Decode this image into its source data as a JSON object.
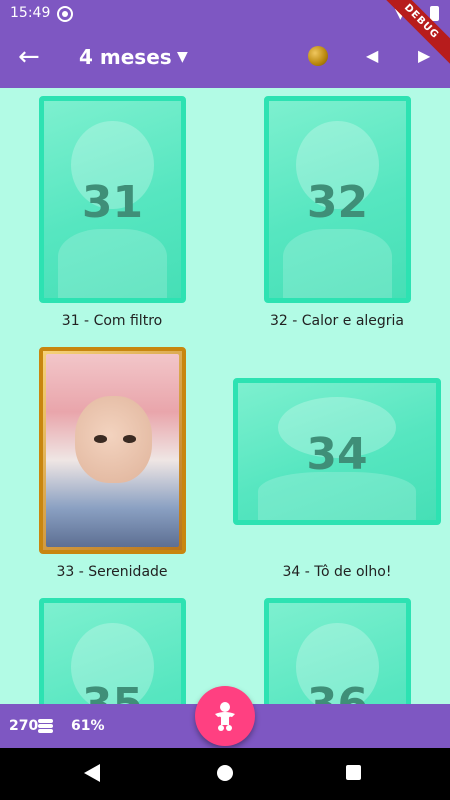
{
  "status_bar": {
    "time": "15:49"
  },
  "debug_banner": "DEBUG",
  "app_bar": {
    "title": "4 meses",
    "back_icon": "arrow-back-icon",
    "dropdown_icon": "caret-down-icon",
    "coin_icon": "gold-coin-icon",
    "prev_icon": "triangle-left-icon",
    "next_icon": "triangle-right-icon"
  },
  "photos": [
    {
      "number": "31",
      "caption": "31 - Com filtro",
      "locked": true
    },
    {
      "number": "32",
      "caption": "32 - Calor e alegria",
      "locked": true
    },
    {
      "number": "33",
      "caption": "33 - Serenidade",
      "locked": false
    },
    {
      "number": "34",
      "caption": "34 - Tô de olho!",
      "locked": true
    },
    {
      "number": "35",
      "caption": "",
      "locked": true
    },
    {
      "number": "36",
      "caption": "",
      "locked": true
    }
  ],
  "bottom_bar": {
    "coins": "270",
    "coins_icon": "coin-stack-icon",
    "progress": "61%"
  },
  "fab_icon": "baby-icon",
  "colors": {
    "primary": "#7e57c2",
    "background": "#b2fbe5",
    "card_border": "#2de2b2",
    "fab": "#ff4081",
    "gold": "#c8860f"
  }
}
